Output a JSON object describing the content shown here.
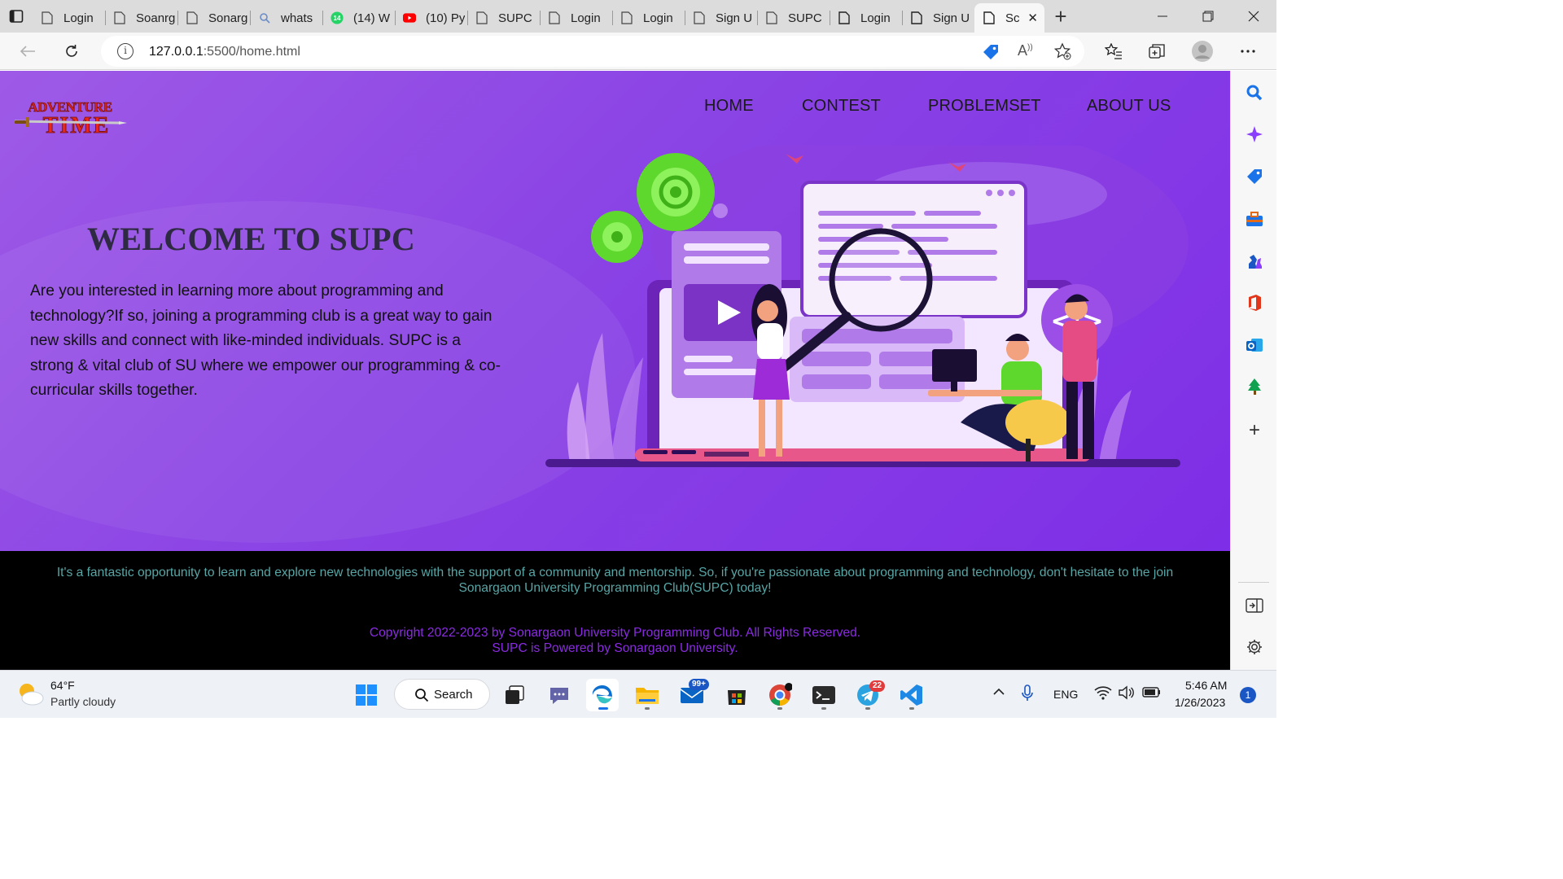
{
  "browser": {
    "tabs": [
      {
        "label": "Login",
        "icon": "page-icon"
      },
      {
        "label": "Soanrg",
        "icon": "page-icon"
      },
      {
        "label": "Sonarg",
        "icon": "page-icon"
      },
      {
        "label": "whats",
        "icon": "search-icon"
      },
      {
        "label": "(14) W",
        "icon": "whatsapp-icon",
        "badge": "14"
      },
      {
        "label": "(10) Py",
        "icon": "youtube-icon"
      },
      {
        "label": "SUPC",
        "icon": "page-icon"
      },
      {
        "label": "Login",
        "icon": "page-icon"
      },
      {
        "label": "Login",
        "icon": "page-icon"
      },
      {
        "label": "Sign U",
        "icon": "page-icon"
      },
      {
        "label": "SUPC",
        "icon": "page-icon"
      },
      {
        "label": "Login",
        "icon": "page-icon"
      },
      {
        "label": "Sign U",
        "icon": "page-icon"
      },
      {
        "label": "Sc",
        "icon": "page-icon",
        "active": true
      }
    ],
    "url_host": "127.0.0.1",
    "url_rest": ":5500/home.html"
  },
  "page": {
    "logo_line1": "ADVENTURE",
    "logo_line2": "TIME",
    "nav": [
      "HOME",
      "CONTEST",
      "PROBLEMSET",
      "ABOUT US"
    ],
    "welcome": "WELCOME TO SUPC",
    "intro": "Are you interested in learning more about programming and technology?If so, joining a programming club is a great way to gain new skills and connect with like-minded individuals. SUPC is a strong & vital club of SU where we empower our programming & co-curricular skills together.",
    "code_tag": "</>",
    "footer_msg": "It's a fantastic opportunity to learn and explore new technologies with the support of a community and mentorship. So, if you're passionate about programming and technology, don't hesitate to the join Sonargaon University Programming Club(SUPC) today!",
    "copyright_line1": "Copyright 2022-2023 by Sonargaon University Programming Club. All Rights Reserved.",
    "copyright_line2": "SUPC is Powered by Sonargaon University."
  },
  "taskbar": {
    "temperature": "64°F",
    "weather": "Partly cloudy",
    "search_label": "Search",
    "mail_badge": "99+",
    "telegram_badge": "22",
    "language": "ENG",
    "time": "5:46 AM",
    "date": "1/26/2023",
    "notifications": "1"
  },
  "colors": {
    "hero_purple": "#8a43e5",
    "footer_teal": "#58a6a6",
    "footer_violet": "#8a2be2"
  }
}
